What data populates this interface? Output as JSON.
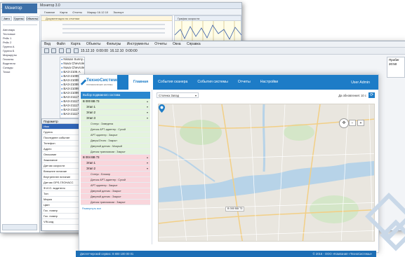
{
  "back_window": {
    "title": "Монитор 3.0",
    "logo": "Монитор",
    "tabs": [
      "Главное",
      "Карта",
      "Отчеты",
      "Маршр 16.12.10",
      "Экспорт"
    ],
    "left_tabs": [
      "Авто",
      "Группы",
      "Объекты"
    ],
    "tree": [
      "Автопарк",
      "Тестовые",
      "Рейс 1",
      "Рейс 2",
      "Группа А",
      "Группа Б",
      "Маршруты",
      "Геозоны",
      "Водители",
      "Склады",
      "Точки"
    ],
    "doc_title": "Документация по отчетам",
    "chart_title": "График скорости"
  },
  "mid_window": {
    "menu": [
      "Вид",
      "Файл",
      "Карта",
      "Объекты",
      "Фильтры",
      "Инструменты",
      "Отчеты",
      "Окна",
      "Справка"
    ],
    "toolbar_date_from": "15.12.10",
    "toolbar_time_from": "0:00:00",
    "toolbar_date_to": "16.12.10",
    "toolbar_time_to": "0:00:00",
    "vehicles": [
      "Nissan Sunny A 200 DZ",
      "Nuva Chevrolet A 583 DY",
      "Nuva Chevrolet",
      "BA3-2106 A",
      "BA3-21099",
      "BA3-21099",
      "BA3-21099 A",
      "BA3-21099 A",
      "BA3-21099 A",
      "BA3-21117",
      "BA3-21117",
      "BA3-21117",
      "BA3-21117",
      "BA3-21117"
    ],
    "right_pane": [
      "Пробег",
      "20:50"
    ],
    "param_header": "Параметр",
    "params": [
      "Имя",
      "Группа",
      "Последнее событие",
      "Телефон",
      "Адрес",
      "Описание",
      "Зажигание",
      "Датчик скорости",
      "Внешнее питание",
      "Внутреннее питание",
      "Датчик GPS-ГЛОНАСС",
      "Ф.И.О. водителя",
      "Тип",
      "Марка",
      "Цвет",
      "Гос. номер",
      "Гос. номер",
      "VIN-код"
    ]
  },
  "web": {
    "logo_title": "ТехноСистемы",
    "logo_sub": "телематические системы",
    "nav": [
      "Главная",
      "События сканера",
      "События системы",
      "Отчеты",
      "Настройки"
    ],
    "user": "User Admin",
    "status_panel_title": "Выбор подвижного состава",
    "toolbar_select": "Стоянка Запад",
    "refresh_label": "Да обновления: 10 с",
    "groups": [
      {
        "title": "В 000 ВВ 73",
        "tone": "green",
        "stages": [
          "Этап 1",
          "Этап 2",
          "Этап 3"
        ],
        "rows": [
          "Статус : Заведена",
          "Датчик АРТ-адаптер : Сухой",
          "АРТ адаптер : Закрыт",
          "Дверь/Отсек : Закрыт",
          "Дверной датчик : Мокрый",
          "Датчик трансмисии : Закрыт"
        ]
      },
      {
        "title": "В 004 ВВ 73",
        "tone": "red",
        "stages": [
          "Этап 1",
          "Этап 2"
        ],
        "rows": [
          "Статус : Блокир",
          "Датчик АРТ-адаптер : Сухой",
          "АРТ адаптер : Закрыт",
          "Дверной датчик : Закрыт",
          "Дверной датчик : Закрыт",
          "Датчик трансмисии : Закрыт"
        ]
      }
    ],
    "show_all": "Развернуть все",
    "marker_label": "В 000 ВВ 73",
    "footer_left": "Диспетчерский сервис: 8 800 100 00 01",
    "footer_right": "© 2016 - ООО «Компания «ТехноСистемы»",
    "colors": {
      "nav_blue": "#1d7cc7",
      "green_row": "#e4f4de",
      "red_row": "#f9d6dc"
    }
  }
}
